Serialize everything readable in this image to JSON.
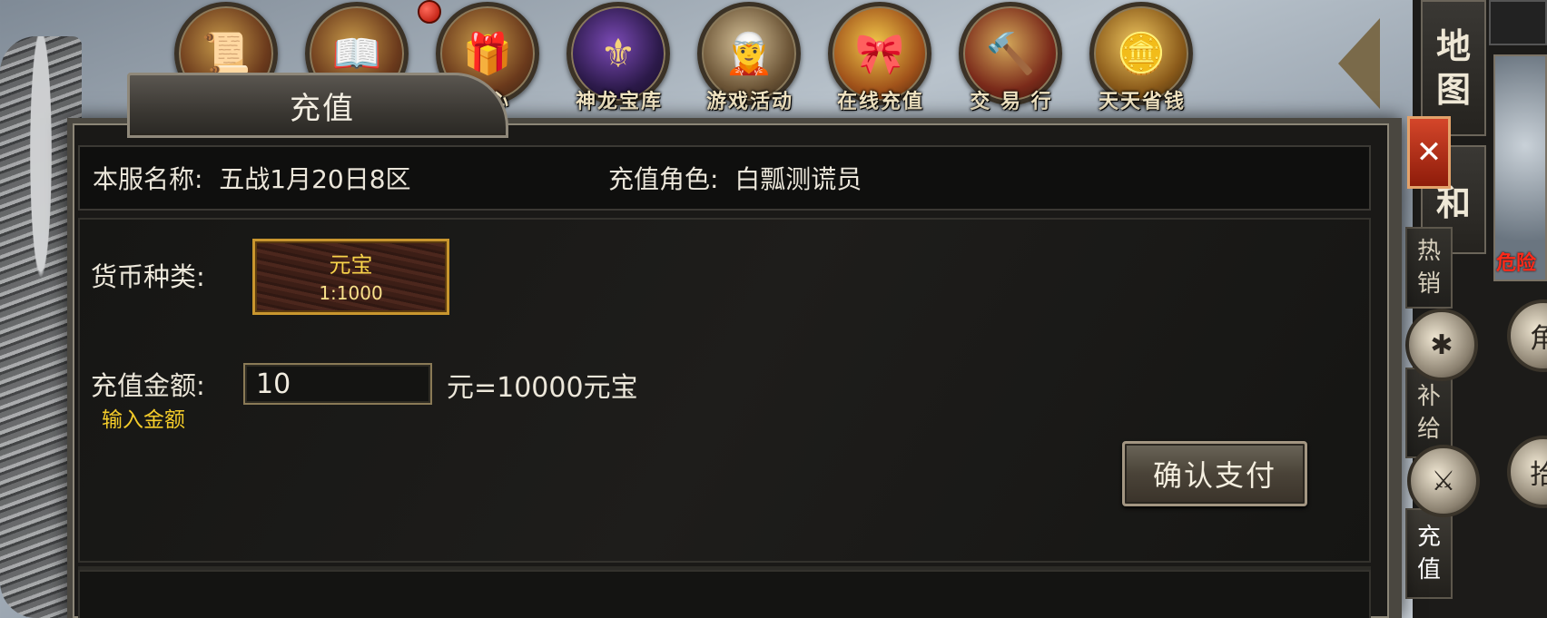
{
  "top_bar": {
    "icons": [
      {
        "label": "",
        "icon": "scroll-icon"
      },
      {
        "label": "",
        "icon": "book-icon"
      },
      {
        "label": "中心",
        "icon": "gift-box-icon"
      },
      {
        "label": "神龙宝库",
        "icon": "dragon-helmet-icon"
      },
      {
        "label": "游戏活动",
        "icon": "character-icon"
      },
      {
        "label": "在线充值",
        "icon": "gold-gift-icon"
      },
      {
        "label": "交 易 行",
        "icon": "gavel-icon"
      },
      {
        "label": "天天省钱",
        "icon": "coins-icon"
      }
    ]
  },
  "right_panel": {
    "map_tab": [
      "地",
      "图"
    ],
    "tab2": "和",
    "danger_text": "危险",
    "side_tabs": [
      {
        "chars": [
          "热",
          "销"
        ]
      },
      {
        "chars": [
          "补",
          "给"
        ]
      },
      {
        "chars": [
          "充",
          "值"
        ]
      }
    ],
    "round_button_char": "拾",
    "round_button_char2": "角"
  },
  "dialog": {
    "title": "充值",
    "close_label": "✕",
    "server_label": "本服名称:",
    "server_name": "五战1月20日8区",
    "role_label": "充值角色:",
    "role_name": "白瓢测谎员",
    "currency_label": "货币种类:",
    "currency_option": {
      "name": "元宝",
      "rate": "1:1000"
    },
    "amount_label": "充值金额:",
    "amount_value": "10",
    "amount_hint": "输入金额",
    "conversion_text": "元=10000元宝",
    "confirm_label": "确认支付"
  },
  "colors": {
    "gold_text": "#f8d34a",
    "hint_yellow": "#f4cc2a",
    "close_red": "#d4462a",
    "danger_red": "#ff2a1a"
  }
}
